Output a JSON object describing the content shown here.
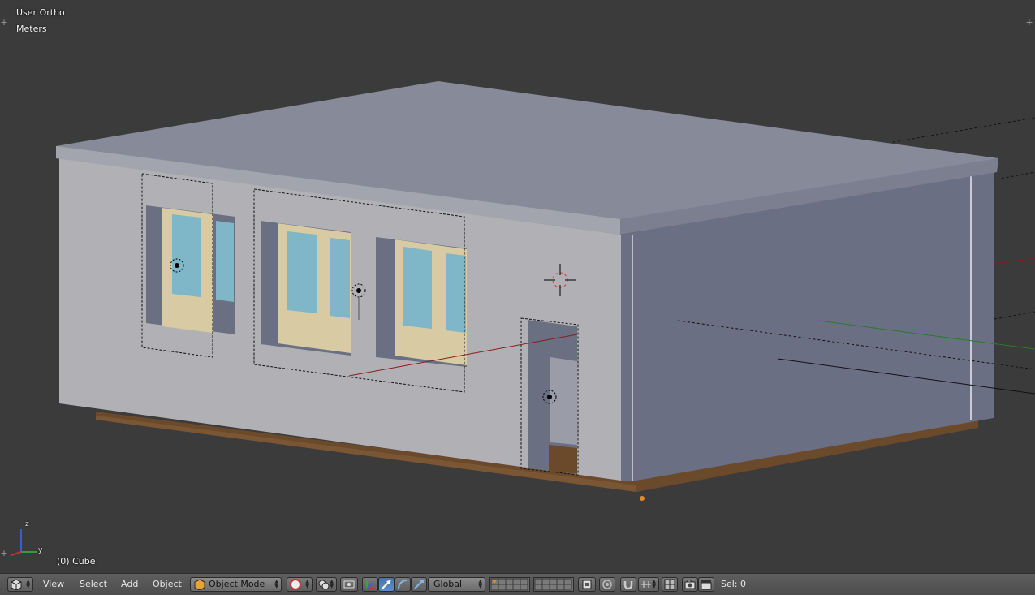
{
  "viewport": {
    "view_name": "User Ortho",
    "units": "Meters",
    "object_info": "(0) Cube",
    "axes": {
      "z": "z",
      "y": "y"
    }
  },
  "header": {
    "editor_type_icon": "cube-icon",
    "menus": [
      "View",
      "Select",
      "Add",
      "Object"
    ],
    "mode": {
      "icon": "object-mode-cube-icon",
      "label": "Object Mode"
    },
    "orientation": "Global",
    "selection_status": "Sel: 0"
  },
  "colors": {
    "viewport_bg": "#3b3b3b",
    "header_bg": "#535353",
    "wall_front": "#b0b0b4",
    "wall_side": "#6a6f82",
    "roof": "#878a99",
    "floor_wood": "#6b4a2c",
    "window_frame": "#d8caa3",
    "glass": "#7fb6c8"
  }
}
